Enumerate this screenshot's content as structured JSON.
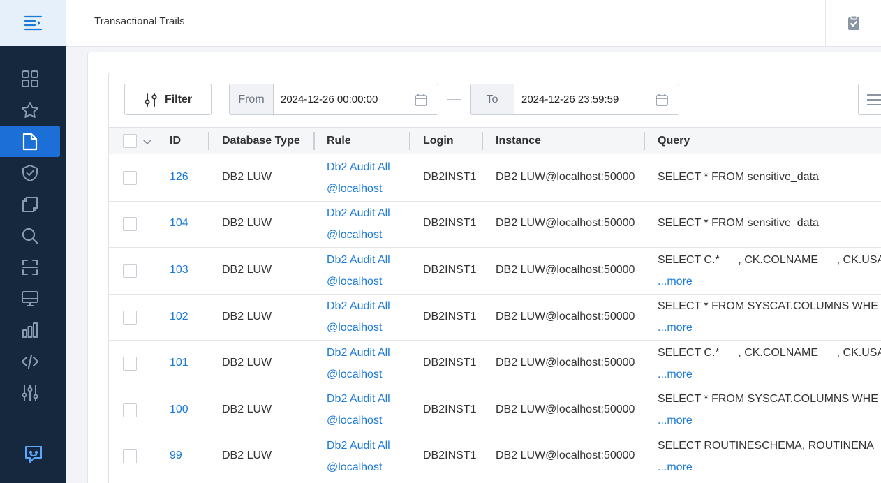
{
  "header": {
    "title": "Transactional Trails"
  },
  "sidebar": {
    "items": [
      {
        "icon": "grid-icon"
      },
      {
        "icon": "star-icon"
      },
      {
        "icon": "document-icon",
        "active": true
      },
      {
        "icon": "shield-check-icon"
      },
      {
        "icon": "copy-icon"
      },
      {
        "icon": "search-icon"
      },
      {
        "icon": "scan-icon"
      },
      {
        "icon": "monitor-icon"
      },
      {
        "icon": "bar-chart-icon"
      },
      {
        "icon": "code-icon"
      },
      {
        "icon": "sliders-icon"
      }
    ],
    "bottom_icon": "chat-feedback-icon"
  },
  "toolbar": {
    "filter_label": "Filter",
    "from_label": "From",
    "from_value": "2024-12-26 00:00:00",
    "to_label": "To",
    "to_value": "2024-12-26 23:59:59"
  },
  "table": {
    "columns": [
      "ID",
      "Database Type",
      "Rule",
      "Login",
      "Instance",
      "Query"
    ],
    "more_label": "...more",
    "rows": [
      {
        "id": "126",
        "db_type": "DB2 LUW",
        "rule_1": "Db2 Audit All",
        "rule_2": "@localhost",
        "login": "DB2INST1",
        "instance": "DB2 LUW@localhost:50000",
        "query": "SELECT * FROM sensitive_data",
        "more": false
      },
      {
        "id": "104",
        "db_type": "DB2 LUW",
        "rule_1": "Db2 Audit All",
        "rule_2": "@localhost",
        "login": "DB2INST1",
        "instance": "DB2 LUW@localhost:50000",
        "query": "SELECT * FROM sensitive_data",
        "more": false
      },
      {
        "id": "103",
        "db_type": "DB2 LUW",
        "rule_1": "Db2 Audit All",
        "rule_2": "@localhost",
        "login": "DB2INST1",
        "instance": "DB2 LUW@localhost:50000",
        "query": "SELECT C.*      , CK.COLNAME      , CK.USA",
        "more": true
      },
      {
        "id": "102",
        "db_type": "DB2 LUW",
        "rule_1": "Db2 Audit All",
        "rule_2": "@localhost",
        "login": "DB2INST1",
        "instance": "DB2 LUW@localhost:50000",
        "query": "SELECT * FROM SYSCAT.COLUMNS WHE",
        "more": true
      },
      {
        "id": "101",
        "db_type": "DB2 LUW",
        "rule_1": "Db2 Audit All",
        "rule_2": "@localhost",
        "login": "DB2INST1",
        "instance": "DB2 LUW@localhost:50000",
        "query": "SELECT C.*      , CK.COLNAME      , CK.USA",
        "more": true
      },
      {
        "id": "100",
        "db_type": "DB2 LUW",
        "rule_1": "Db2 Audit All",
        "rule_2": "@localhost",
        "login": "DB2INST1",
        "instance": "DB2 LUW@localhost:50000",
        "query": "SELECT * FROM SYSCAT.COLUMNS WHE",
        "more": true
      },
      {
        "id": "99",
        "db_type": "DB2 LUW",
        "rule_1": "Db2 Audit All",
        "rule_2": "@localhost",
        "login": "DB2INST1",
        "instance": "DB2 LUW@localhost:50000",
        "query": "SELECT ROUTINESCHEMA, ROUTINENA",
        "more": true
      }
    ]
  },
  "colors": {
    "sidebar_bg": "#16283d",
    "accent": "#1b6fd6",
    "link": "#1a7ad9"
  }
}
